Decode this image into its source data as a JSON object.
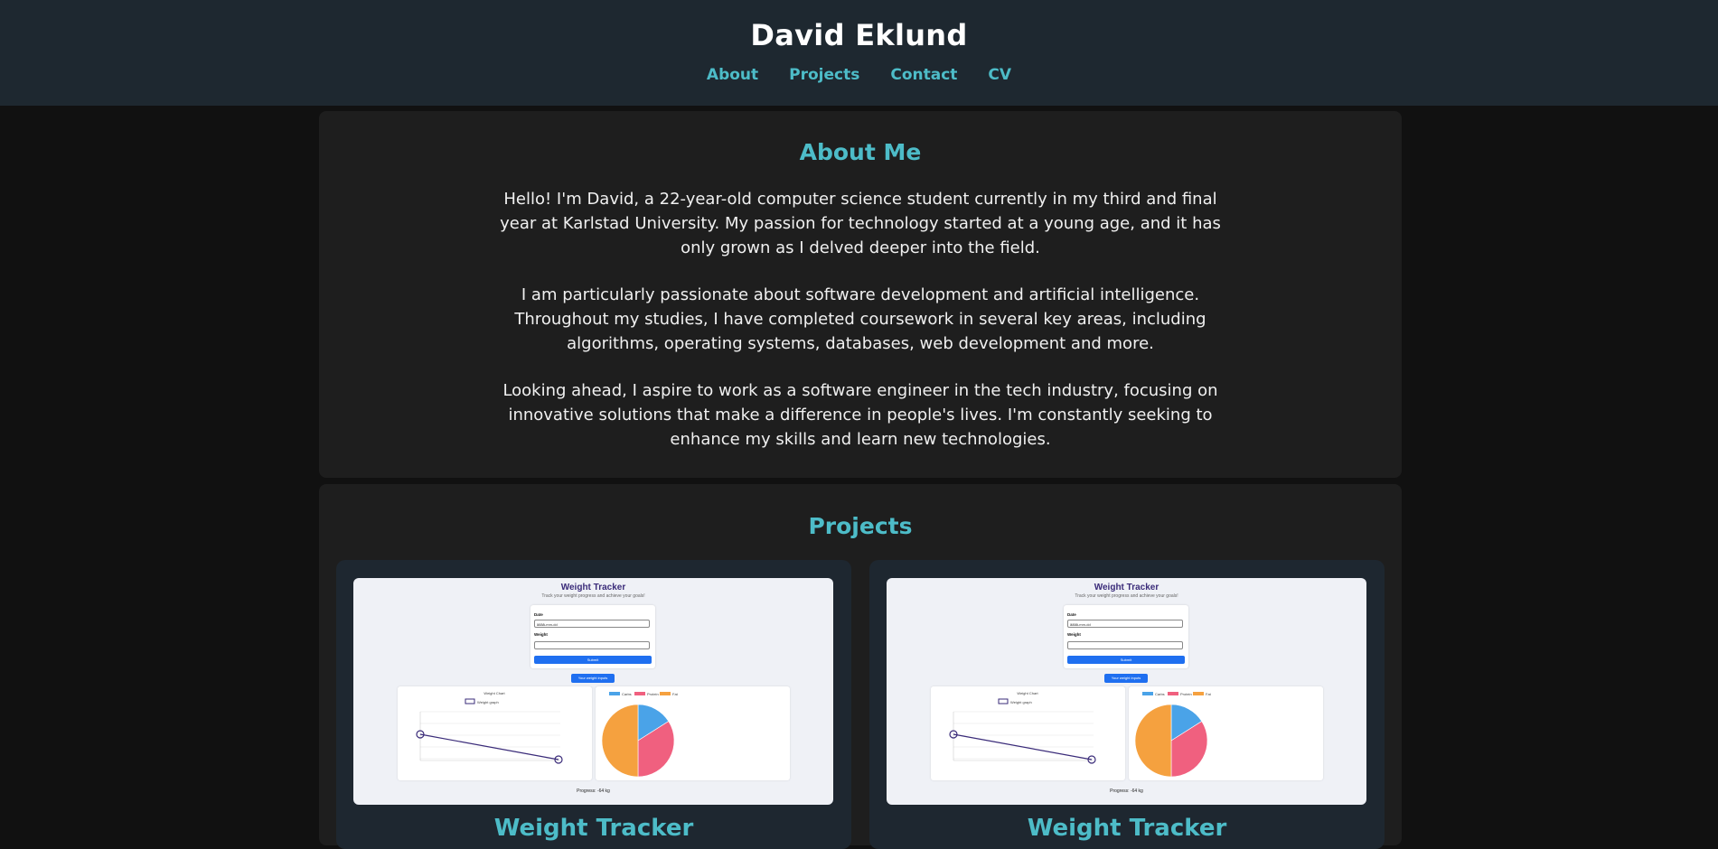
{
  "header": {
    "title": "David Eklund",
    "nav": [
      "About",
      "Projects",
      "Contact",
      "CV"
    ]
  },
  "about": {
    "title": "About Me",
    "paragraphs": [
      "Hello! I'm David, a 22-year-old computer science student currently in my third and final year at Karlstad University. My passion for technology started at a young age, and it has only grown as I delved deeper into the field.",
      "I am particularly passionate about software development and artificial intelligence. Throughout my studies, I have completed coursework in several key areas, including algorithms, operating systems, databases, web development and more.",
      "Looking ahead, I aspire to work as a software engineer in the tech industry, focusing on innovative solutions that make a difference in people's lives. I'm constantly seeking to enhance my skills and learn new technologies."
    ]
  },
  "projects": {
    "title": "Projects",
    "cards": [
      {
        "title": "Weight Tracker",
        "thumb": {
          "app_title": "Weight Tracker",
          "app_subtitle": "Track your weight progress and achieve your goals!",
          "date_label": "Date",
          "date_value": "åååå-mm-dd",
          "weight_label": "Weight",
          "submit_label": "Submit",
          "dropdown_label": "Your weight inputs",
          "line_chart_title": "Weight Chart",
          "line_legend": "Weight graph",
          "pie_legend": [
            "Carbs",
            "Protein",
            "Fat"
          ],
          "progress_text": "Progress: -64 kg"
        }
      },
      {
        "title": "Weight Tracker",
        "thumb": {
          "app_title": "Weight Tracker",
          "app_subtitle": "Track your weight progress and achieve your goals!",
          "date_label": "Date",
          "date_value": "åååå-mm-dd",
          "weight_label": "Weight",
          "submit_label": "Submit",
          "dropdown_label": "Your weight inputs",
          "line_chart_title": "Weight Chart",
          "line_legend": "Weight graph",
          "pie_legend": [
            "Carbs",
            "Protein",
            "Fat"
          ],
          "progress_text": "Progress: -64 kg"
        }
      }
    ]
  },
  "colors": {
    "accent": "#4dbcc8",
    "header_bg": "#1e2830",
    "section_bg": "#1e1e1e",
    "card_bg": "#1e2730",
    "pie": [
      "#4aa3e8",
      "#f0607f",
      "#f5a13f"
    ]
  },
  "pie_shares": [
    0.16,
    0.34,
    0.5
  ]
}
